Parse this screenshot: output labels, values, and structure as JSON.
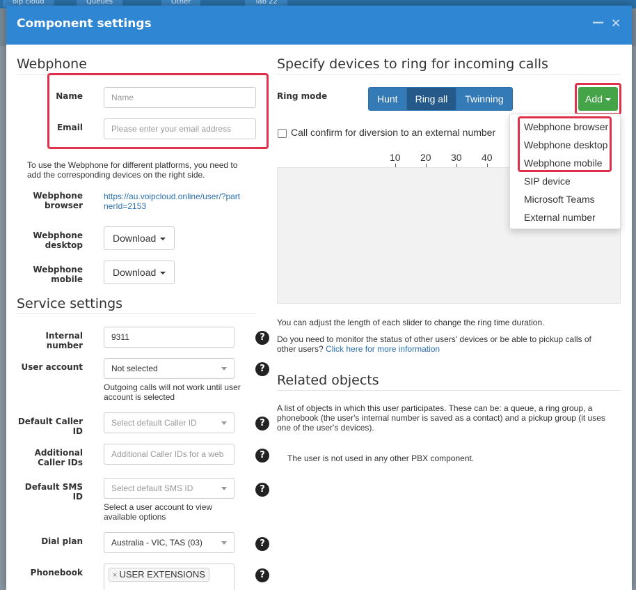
{
  "background": {
    "tabs": [
      "oip cloud",
      "Queues",
      "Other",
      "Tab 22"
    ]
  },
  "modal": {
    "title": "Component settings",
    "minimize_icon": "minus-icon",
    "close_icon": "close-icon"
  },
  "webphone": {
    "title": "Webphone",
    "name_label": "Name",
    "name_placeholder": "Name",
    "email_label": "Email",
    "email_placeholder": "Please enter your email address",
    "info_text": "To use the Webphone for different platforms, you need to add the corresponding devices on the right side.",
    "browser_label": "Webphone browser",
    "browser_link": "https://au.voipcloud.online/user/?partnerId=2153",
    "desktop_label": "Webphone desktop",
    "desktop_button": "Download",
    "mobile_label": "Webphone mobile",
    "mobile_button": "Download"
  },
  "service": {
    "title": "Service settings",
    "internal_number_label": "Internal number",
    "internal_number_value": "9311",
    "user_account_label": "User account",
    "user_account_value": "Not selected",
    "user_account_note": "Outgoing calls will not work until user account is selected",
    "default_caller_id_label": "Default Caller ID",
    "default_caller_id_placeholder": "Select default Caller ID",
    "additional_caller_ids_label": "Additional Caller IDs",
    "additional_caller_ids_placeholder": "Additional Caller IDs for a web",
    "default_sms_id_label": "Default SMS ID",
    "default_sms_id_placeholder": "Select default SMS ID",
    "default_sms_id_note": "Select a user account to view available options",
    "dial_plan_label": "Dial plan",
    "dial_plan_value": "Australia - VIC, TAS (03)",
    "phonebook_label": "Phonebook",
    "phonebook_tag": "USER EXTENSIONS",
    "tag_remove": "×",
    "help_glyph": "?"
  },
  "ring": {
    "title": "Specify devices to ring for incoming calls",
    "mode_label": "Ring mode",
    "modes": [
      "Hunt",
      "Ring all",
      "Twinning"
    ],
    "active_mode": "Ring all",
    "add_button": "Add",
    "confirm_label": "Call confirm for diversion to an external number",
    "ticks": [
      "10",
      "20",
      "30",
      "40"
    ],
    "slider_note": "You can adjust the length of each slider to change the ring time duration.",
    "monitor_note": "Do you need to monitor the status of other users' devices or be able to pickup calls of other users?",
    "monitor_link": "Click here for more information",
    "add_menu": [
      "Webphone browser",
      "Webphone desktop",
      "Webphone mobile",
      "SIP device",
      "Microsoft Teams",
      "External number"
    ]
  },
  "related": {
    "title": "Related objects",
    "description": "A list of objects in which this user participates. These can be: a queue, a ring group, a phonebook (the user's internal number is saved as a contact) and a pickup group (it uses one of the user's devices).",
    "empty_text": "The user is not used in any other PBX component."
  },
  "colors": {
    "header": "#2f86d2",
    "highlight": "#e0314a",
    "add_button": "#44a447",
    "segment": "#337ab7",
    "segment_active": "#24598a"
  }
}
